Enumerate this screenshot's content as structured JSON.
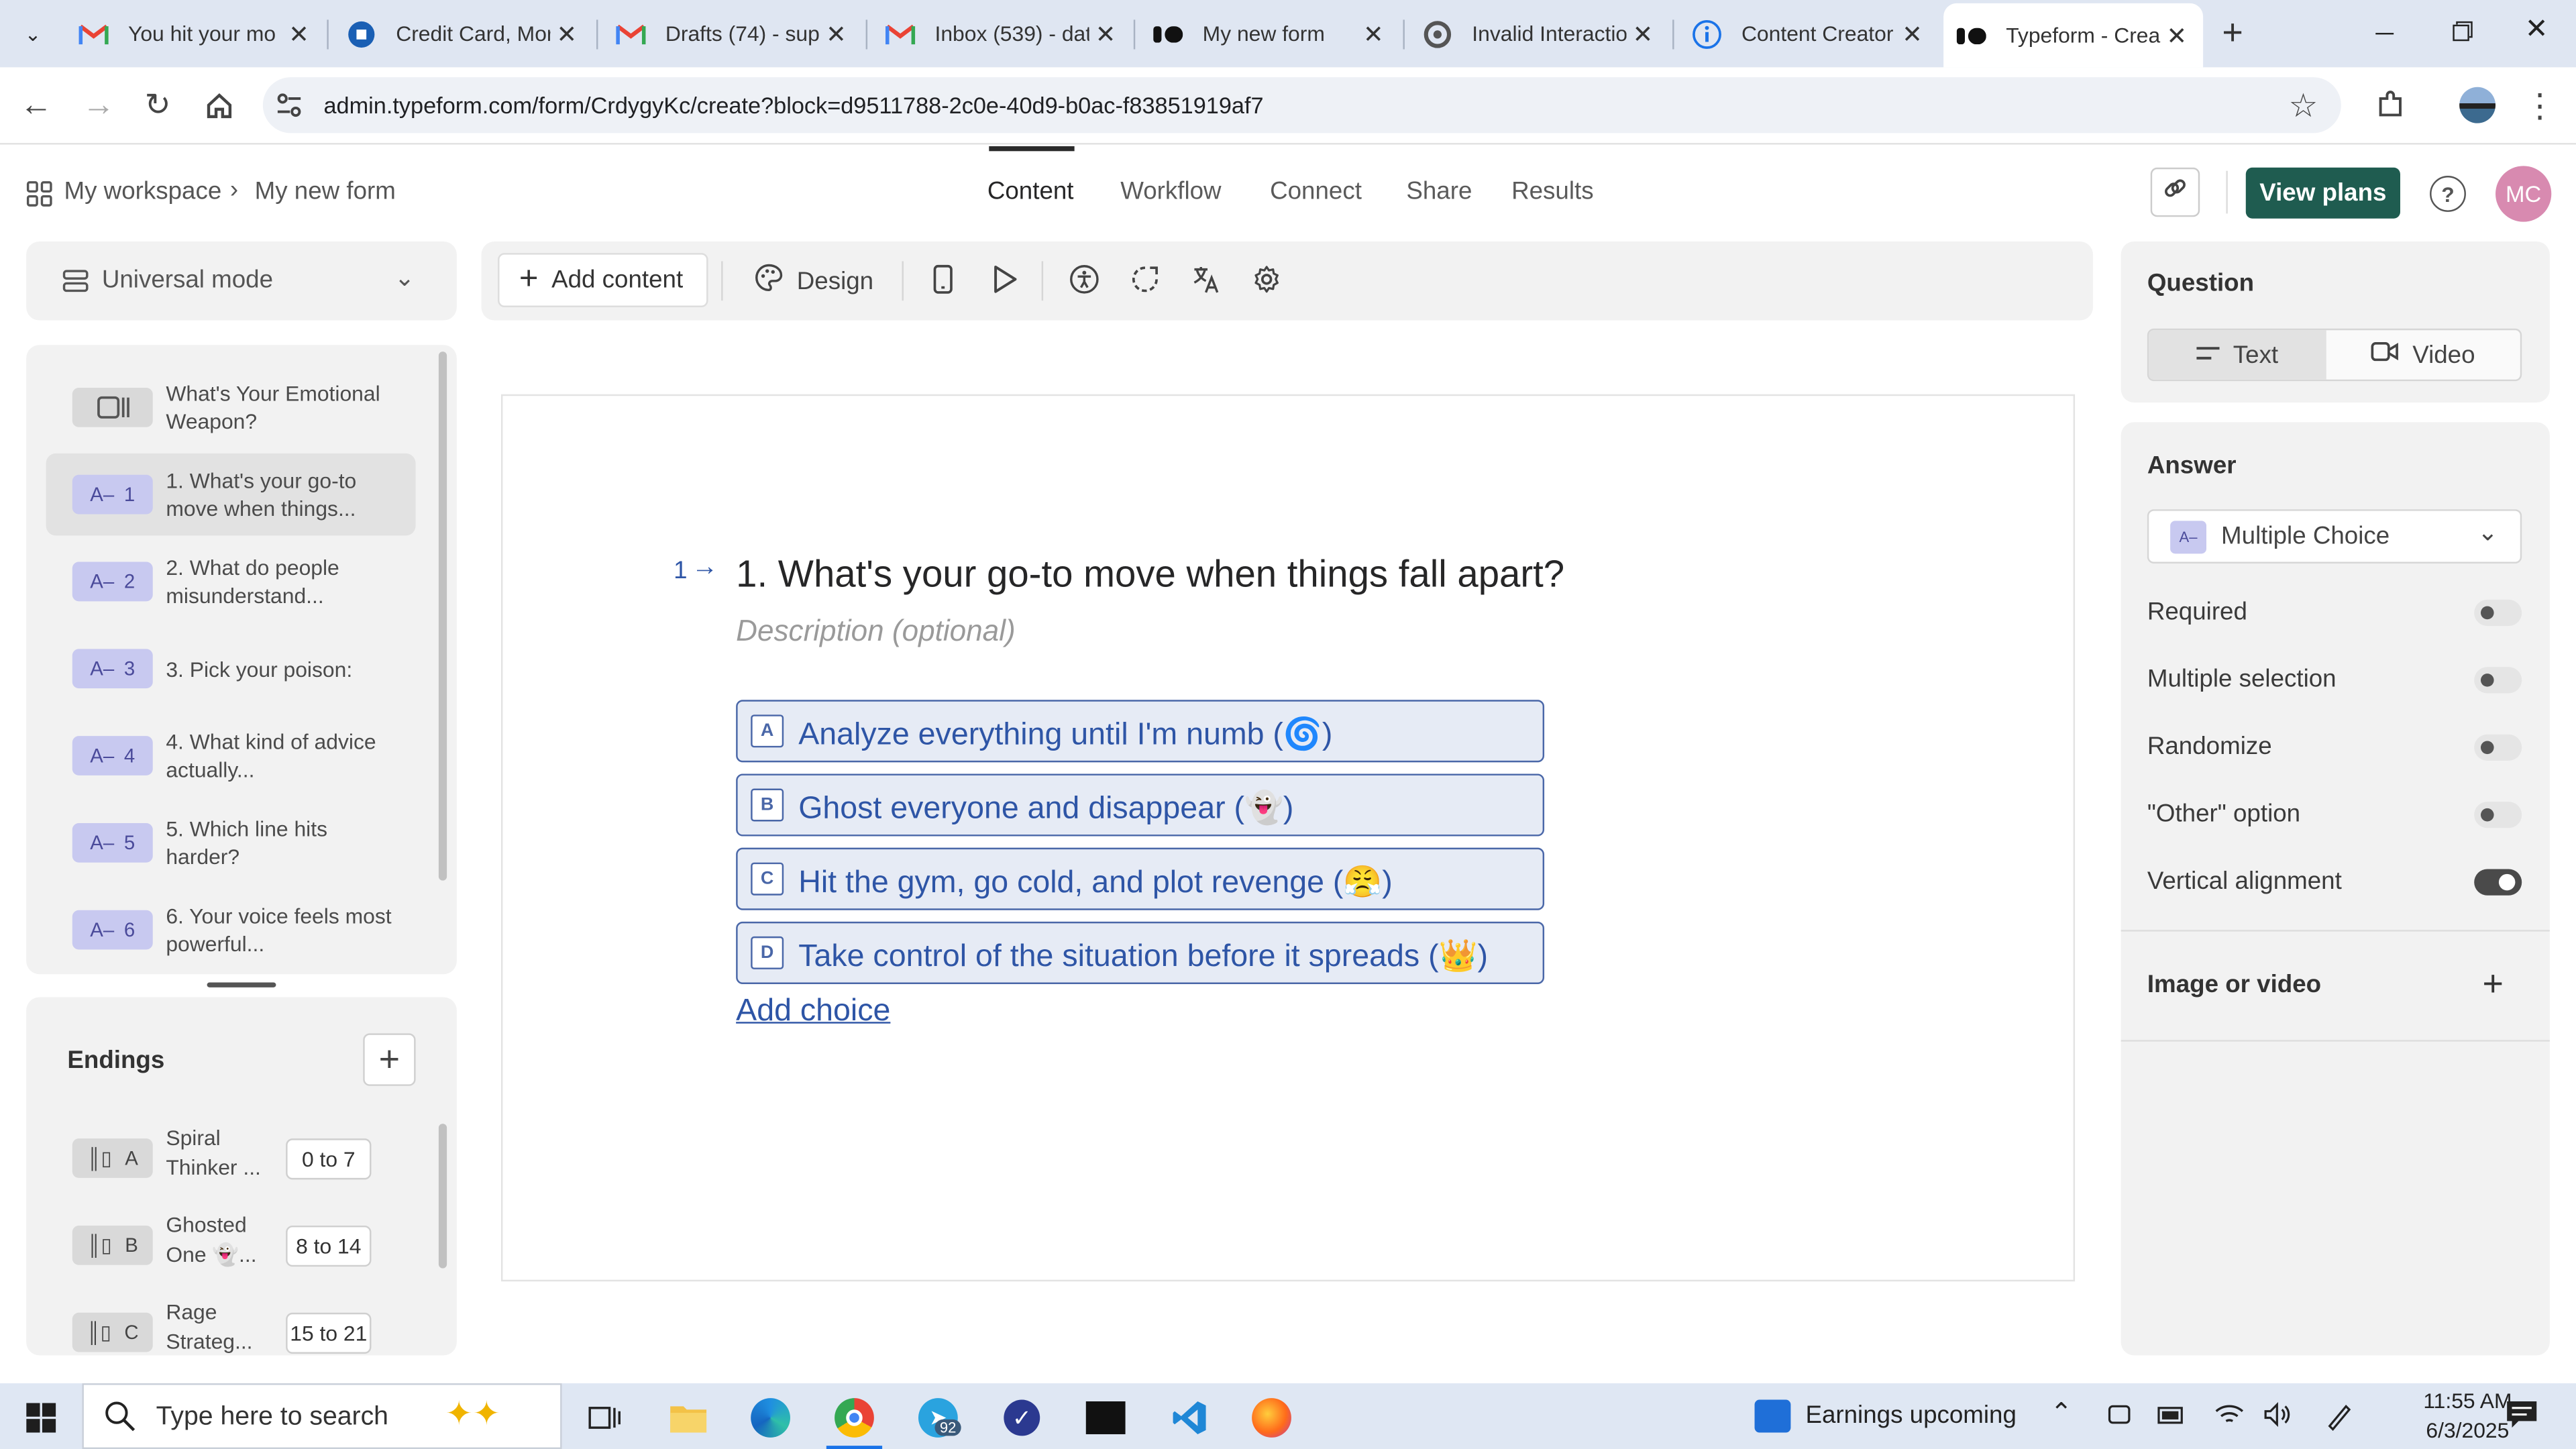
{
  "browser": {
    "tabs": [
      {
        "title": "You hit your mo",
        "icon": "gmail-icon"
      },
      {
        "title": "Credit Card, Mor",
        "icon": "chase-icon"
      },
      {
        "title": "Drafts (74) - sup",
        "icon": "gmail-icon"
      },
      {
        "title": "Inbox (539) - dat",
        "icon": "gmail-icon"
      },
      {
        "title": "My new form",
        "icon": "typeform-icon"
      },
      {
        "title": "Invalid Interactio",
        "icon": "openai-icon"
      },
      {
        "title": "Content Creator",
        "icon": "info-icon"
      },
      {
        "title": "Typeform - Crea",
        "icon": "typeform-icon"
      }
    ],
    "url": "admin.typeform.com/form/CrdygyKc/create?block=d9511788-2c0e-40d9-b0ac-f83851919af7"
  },
  "header": {
    "workspace": "My workspace",
    "form_name": "My new form",
    "nav": [
      "Content",
      "Workflow",
      "Connect",
      "Share",
      "Results"
    ],
    "active_nav": "Content",
    "view_plans": "View plans",
    "avatar": "MC"
  },
  "left": {
    "mode": "Universal mode",
    "questions": [
      {
        "num": "",
        "label": "What's Your Emotional Weapon?"
      },
      {
        "num": "1",
        "label": "1. What's your go-to move when things..."
      },
      {
        "num": "2",
        "label": "2. What do people misunderstand..."
      },
      {
        "num": "3",
        "label": "3. Pick your poison:"
      },
      {
        "num": "4",
        "label": "4. What kind of advice actually..."
      },
      {
        "num": "5",
        "label": "5. Which line hits harder?"
      },
      {
        "num": "6",
        "label": "6. Your voice feels most powerful..."
      }
    ],
    "endings_title": "Endings",
    "endings": [
      {
        "key": "A",
        "label": "Spiral Thinker ...",
        "range": "0 to 7"
      },
      {
        "key": "B",
        "label": "Ghosted One 👻...",
        "range": "8 to 14"
      },
      {
        "key": "C",
        "label": "Rage Strateg...",
        "range": "15 to 21"
      }
    ]
  },
  "toolbar": {
    "add_content": "Add content",
    "design": "Design"
  },
  "canvas": {
    "question_number": "1",
    "question": "1. What's your go-to move when things fall apart?",
    "description_placeholder": "Description (optional)",
    "choices": [
      {
        "key": "A",
        "text": "Analyze everything until I'm numb (🌀)"
      },
      {
        "key": "B",
        "text": "Ghost everyone and disappear (👻)"
      },
      {
        "key": "C",
        "text": "Hit the gym, go cold, and plot revenge (😤)"
      },
      {
        "key": "D",
        "text": "Take control of the situation before it spreads (👑)"
      }
    ],
    "add_choice": "Add choice"
  },
  "right": {
    "question_title": "Question",
    "text_tab": "Text",
    "video_tab": "Video",
    "answer_title": "Answer",
    "answer_type": "Multiple Choice",
    "settings": [
      {
        "label": "Required",
        "on": false
      },
      {
        "label": "Multiple selection",
        "on": false
      },
      {
        "label": "Randomize",
        "on": false
      },
      {
        "label": "\"Other\" option",
        "on": false
      },
      {
        "label": "Vertical alignment",
        "on": true
      }
    ],
    "image_video": "Image or video"
  },
  "taskbar": {
    "search_placeholder": "Type here to search",
    "news": "Earnings upcoming",
    "time": "11:55 AM",
    "date": "6/3/2025",
    "telegram_badge": "92"
  },
  "colors": {
    "accent_green": "#1f5c50",
    "choice_blue": "#2e55a6",
    "question_icon": "#c8c9f0"
  }
}
